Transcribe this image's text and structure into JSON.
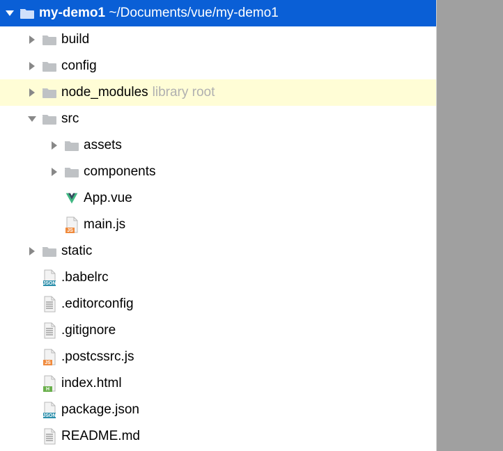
{
  "colors": {
    "selection": "#0a5fd6",
    "library_bg": "#fffdd6",
    "folder": "#bfc2c5",
    "folder_dark": "#b0b3b6",
    "file_fill": "#f3f3f3",
    "file_stroke": "#b8b8b8",
    "js_badge": "#f08a3c",
    "json_badge": "#2b8fab",
    "html_badge": "#6ab04c",
    "vue_dark": "#34495e",
    "vue_green": "#41b883",
    "text_lines": "#9a9a9a"
  },
  "root": {
    "name": "my-demo1",
    "path": "~/Documents/vue/my-demo1"
  },
  "rows": [
    {
      "depth": 0,
      "arrow": "down",
      "icon": "folder",
      "label_key": "root_combo",
      "bold": true,
      "selected": true
    },
    {
      "depth": 1,
      "arrow": "right",
      "icon": "folder",
      "label": "build"
    },
    {
      "depth": 1,
      "arrow": "right",
      "icon": "folder",
      "label": "config"
    },
    {
      "depth": 1,
      "arrow": "right",
      "icon": "folder",
      "label": "node_modules",
      "hint": "library root",
      "library": true
    },
    {
      "depth": 1,
      "arrow": "down",
      "icon": "folder",
      "label": "src"
    },
    {
      "depth": 2,
      "arrow": "right",
      "icon": "folder",
      "label": "assets"
    },
    {
      "depth": 2,
      "arrow": "right",
      "icon": "folder",
      "label": "components"
    },
    {
      "depth": 2,
      "arrow": "none",
      "icon": "vue",
      "label": "App.vue"
    },
    {
      "depth": 2,
      "arrow": "none",
      "icon": "js",
      "label": "main.js"
    },
    {
      "depth": 1,
      "arrow": "right",
      "icon": "folder",
      "label": "static"
    },
    {
      "depth": 1,
      "arrow": "none",
      "icon": "json",
      "label": ".babelrc"
    },
    {
      "depth": 1,
      "arrow": "none",
      "icon": "text",
      "label": ".editorconfig"
    },
    {
      "depth": 1,
      "arrow": "none",
      "icon": "text",
      "label": ".gitignore"
    },
    {
      "depth": 1,
      "arrow": "none",
      "icon": "js",
      "label": ".postcssrc.js"
    },
    {
      "depth": 1,
      "arrow": "none",
      "icon": "html",
      "label": "index.html"
    },
    {
      "depth": 1,
      "arrow": "none",
      "icon": "json",
      "label": "package.json"
    },
    {
      "depth": 1,
      "arrow": "none",
      "icon": "text",
      "label": "README.md"
    }
  ]
}
